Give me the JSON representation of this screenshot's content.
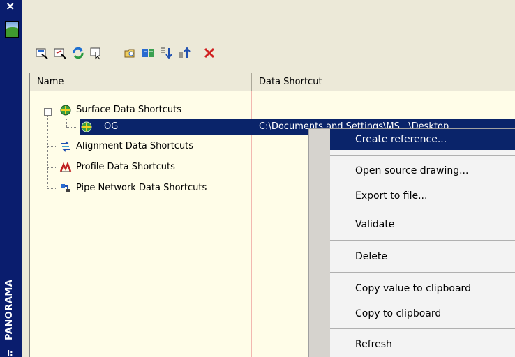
{
  "panorama": {
    "close": "×",
    "label": "PANORAMA",
    "tick": "I:"
  },
  "toolbar": {
    "icons": [
      "create-reference-icon",
      "open-drawing-icon",
      "refresh-icon",
      "select-icon",
      "new-folder-icon",
      "associate-project-icon",
      "move-down-icon",
      "move-up-icon",
      "delete-icon"
    ]
  },
  "columns": {
    "name": "Name",
    "shortcut": "Data Shortcut"
  },
  "tree": {
    "surface": "Surface Data Shortcuts",
    "og": "OG",
    "og_path": "C:\\Documents and Settings\\MS...\\Desktop",
    "alignment": "Alignment Data Shortcuts",
    "profile": "Profile Data Shortcuts",
    "pipe": "Pipe Network Data Shortcuts"
  },
  "menu": {
    "create_reference": "Create reference...",
    "open_source": "Open source drawing...",
    "export": "Export to file...",
    "validate": "Validate",
    "delete": "Delete",
    "copy_value": "Copy value to clipboard",
    "copy": "Copy to clipboard",
    "refresh": "Refresh"
  },
  "colors": {
    "selection": "#0a246a",
    "strip": "#0a1d6e",
    "panel": "#fffde8"
  }
}
